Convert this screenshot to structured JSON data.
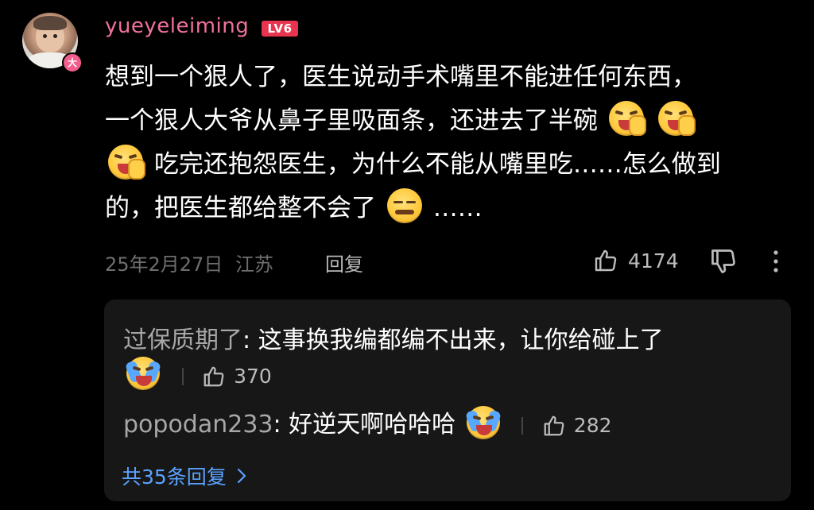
{
  "comment": {
    "username": "yueyeleiming",
    "level": "LV6",
    "avatar_badge": "大",
    "text_parts": {
      "line1": "想到一个狠人了，医生说动手术嘴里不能进任何东西，",
      "line2": "一个狠人大爷从鼻子里吸面条，还进去了半碗",
      "line3": "吃完还抱怨医生，为什么不能从嘴里吃……怎么做到",
      "line4_a": "的，把医生都给整不会了",
      "line4_b": "……"
    },
    "emojis": {
      "laugh_cover": "laugh-cover-mouth-emoji",
      "speechless": "speechless-emoji",
      "crying_laugh": "crying-laugh-emoji"
    },
    "date": "25年2月27日",
    "location": "江苏",
    "reply_label": "回复",
    "like_count": "4174"
  },
  "replies": {
    "items": [
      {
        "author": "过保质期了",
        "text": ": 这事换我编都编不出来，让你给碰上了",
        "like_count": "370"
      },
      {
        "author": "popodan233",
        "text": ": 好逆天啊哈哈哈",
        "like_count": "282"
      }
    ],
    "view_all_label": "共35条回复"
  },
  "colors": {
    "background": "#000000",
    "username": "#f0719c",
    "level_badge": "#e8344e",
    "link": "#5aa2ff",
    "reply_panel": "#171717"
  }
}
